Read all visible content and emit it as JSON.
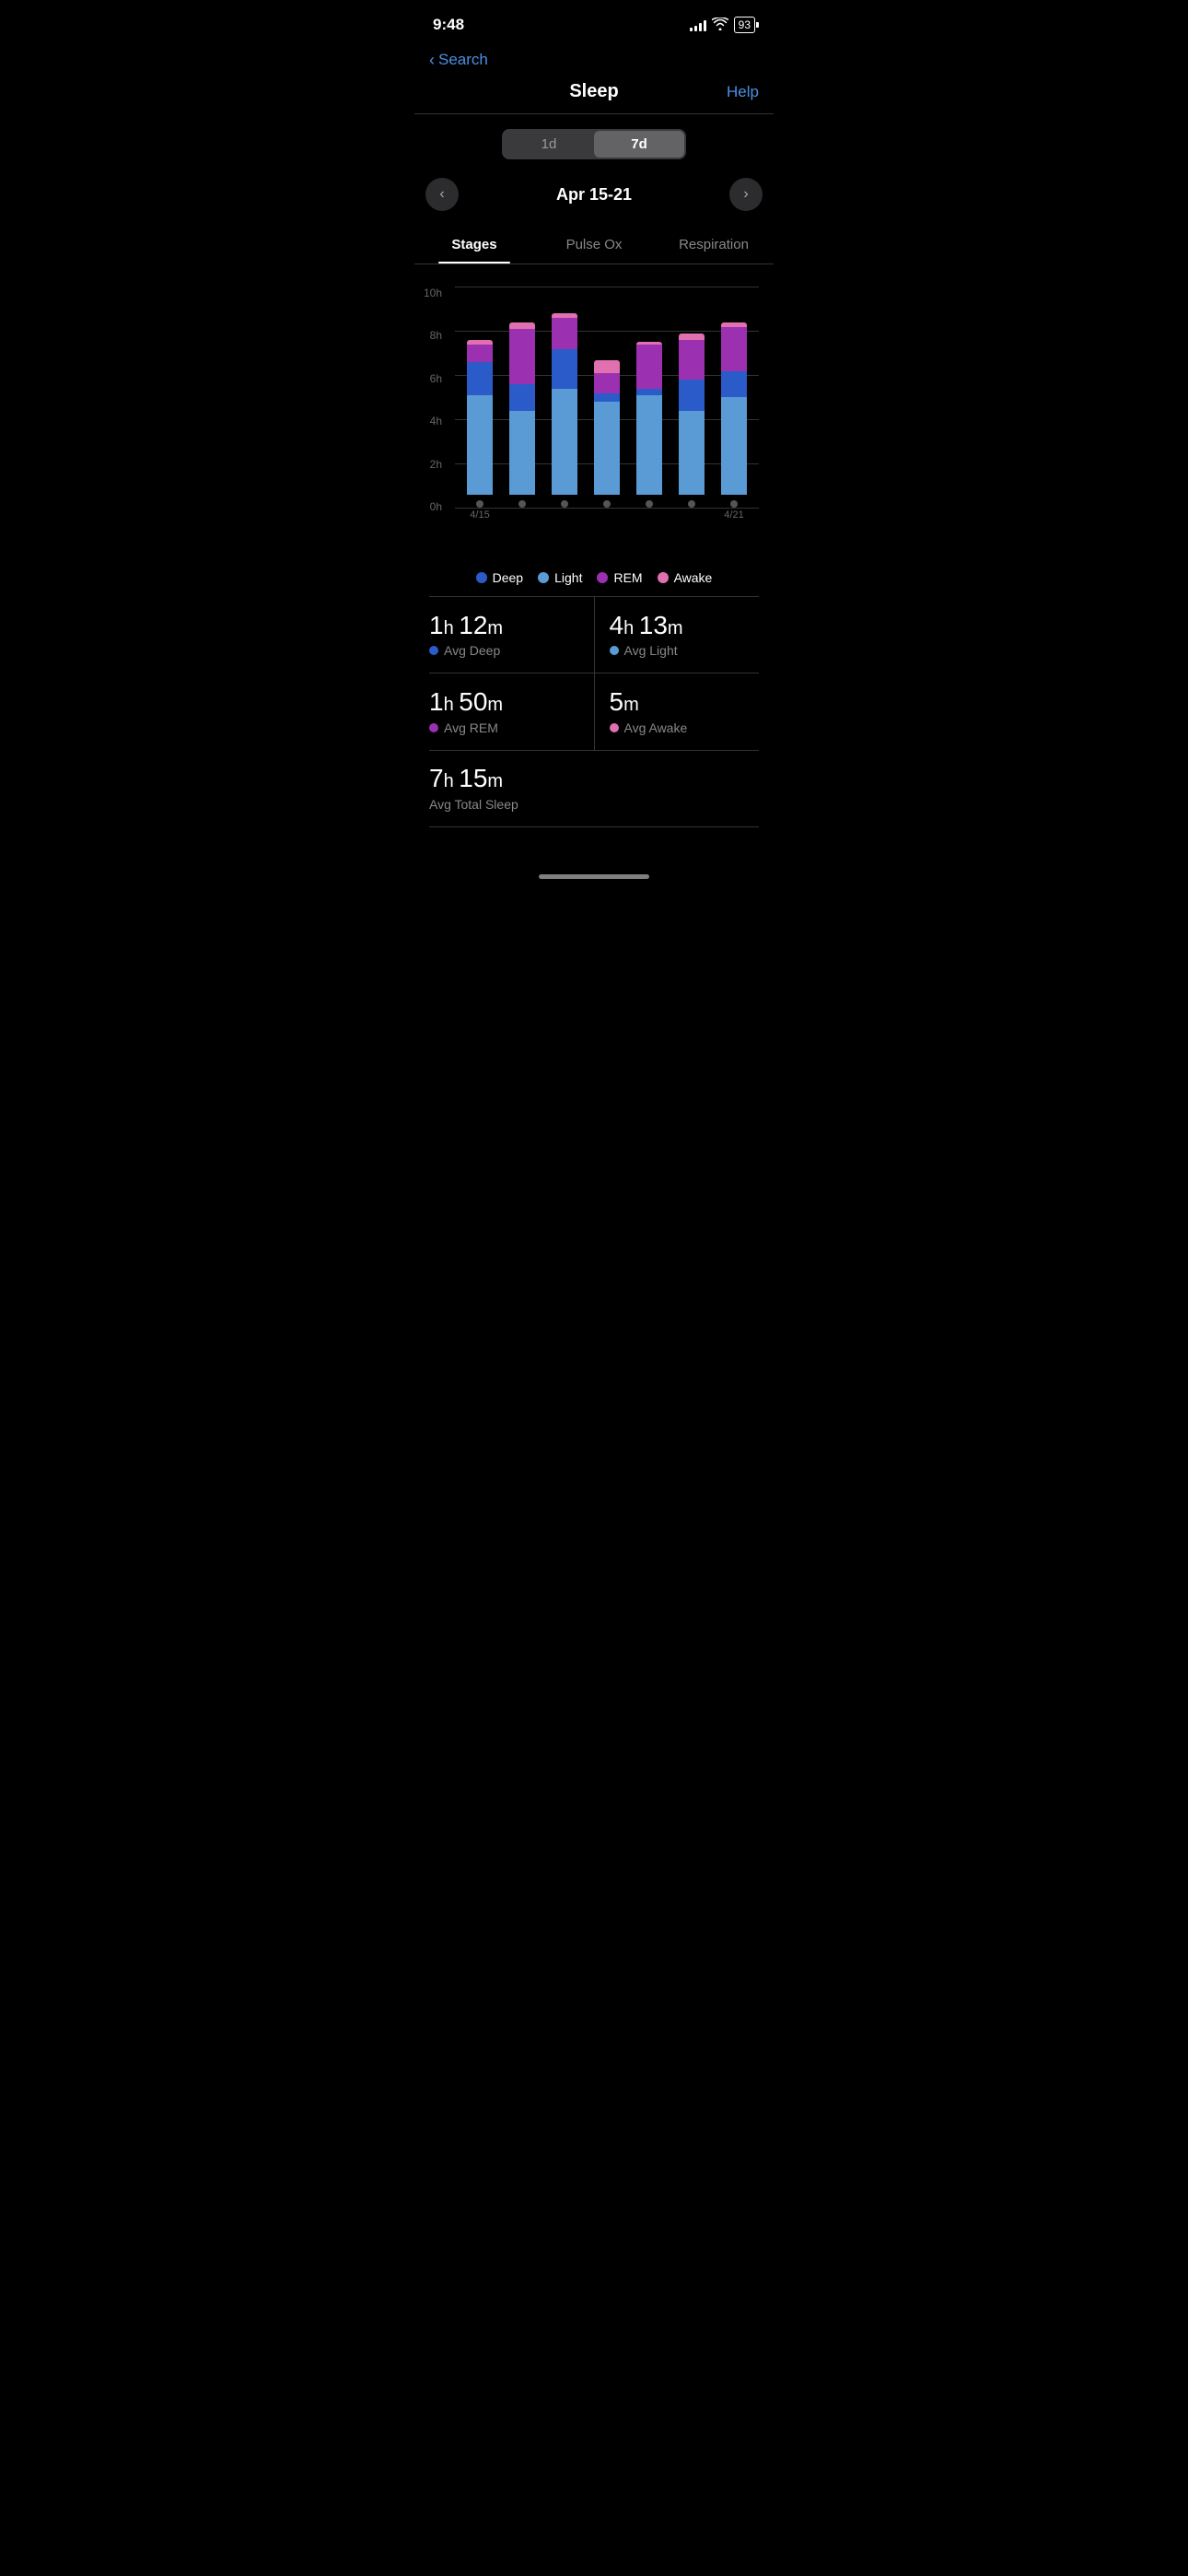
{
  "status": {
    "time": "9:48",
    "battery": "93",
    "signal_bars": [
      3,
      5,
      7,
      10,
      12
    ]
  },
  "nav": {
    "back_label": "Search",
    "title": "Sleep",
    "help_label": "Help"
  },
  "segment": {
    "options": [
      "1d",
      "7d"
    ],
    "active": "7d"
  },
  "date_range": {
    "label": "Apr 15-21",
    "start": "4/15",
    "end": "4/21"
  },
  "tabs": [
    {
      "id": "stages",
      "label": "Stages",
      "active": true
    },
    {
      "id": "pulse-ox",
      "label": "Pulse Ox",
      "active": false
    },
    {
      "id": "respiration",
      "label": "Respiration",
      "active": false
    }
  ],
  "chart": {
    "y_labels": [
      "10h",
      "8h",
      "6h",
      "4h",
      "2h",
      "0h"
    ],
    "max_hours": 10,
    "bars": [
      {
        "date": "4/15",
        "deep": 1.5,
        "light": 4.5,
        "rem": 0.8,
        "awake": 0.2
      },
      {
        "date": "",
        "deep": 1.2,
        "light": 3.8,
        "rem": 2.5,
        "awake": 0.3
      },
      {
        "date": "",
        "deep": 1.8,
        "light": 4.8,
        "rem": 1.4,
        "awake": 0.2
      },
      {
        "date": "",
        "deep": 0.4,
        "light": 4.2,
        "rem": 0.9,
        "awake": 0.6
      },
      {
        "date": "",
        "deep": 0.3,
        "light": 4.5,
        "rem": 2.0,
        "awake": 0.1
      },
      {
        "date": "",
        "deep": 1.4,
        "light": 3.8,
        "rem": 1.8,
        "awake": 0.3
      },
      {
        "date": "4/21",
        "deep": 1.2,
        "light": 4.4,
        "rem": 2.0,
        "awake": 0.2
      }
    ]
  },
  "legend": [
    {
      "label": "Deep",
      "color": "#2B5BC8"
    },
    {
      "label": "Light",
      "color": "#5B9BD5"
    },
    {
      "label": "REM",
      "color": "#9B30B0"
    },
    {
      "label": "Awake",
      "color": "#E070B0"
    }
  ],
  "stats": {
    "avg_deep": {
      "hours": 1,
      "mins": 12,
      "label": "Avg Deep",
      "color": "#2B5BC8"
    },
    "avg_light": {
      "hours": 4,
      "mins": 13,
      "label": "Avg Light",
      "color": "#5B9BD5"
    },
    "avg_rem": {
      "hours": 1,
      "mins": 50,
      "label": "Avg REM",
      "color": "#9B30B0"
    },
    "avg_awake": {
      "mins": 5,
      "label": "Avg Awake",
      "color": "#E070B0"
    },
    "avg_total": {
      "hours": 7,
      "mins": 15,
      "label": "Avg Total Sleep"
    }
  }
}
